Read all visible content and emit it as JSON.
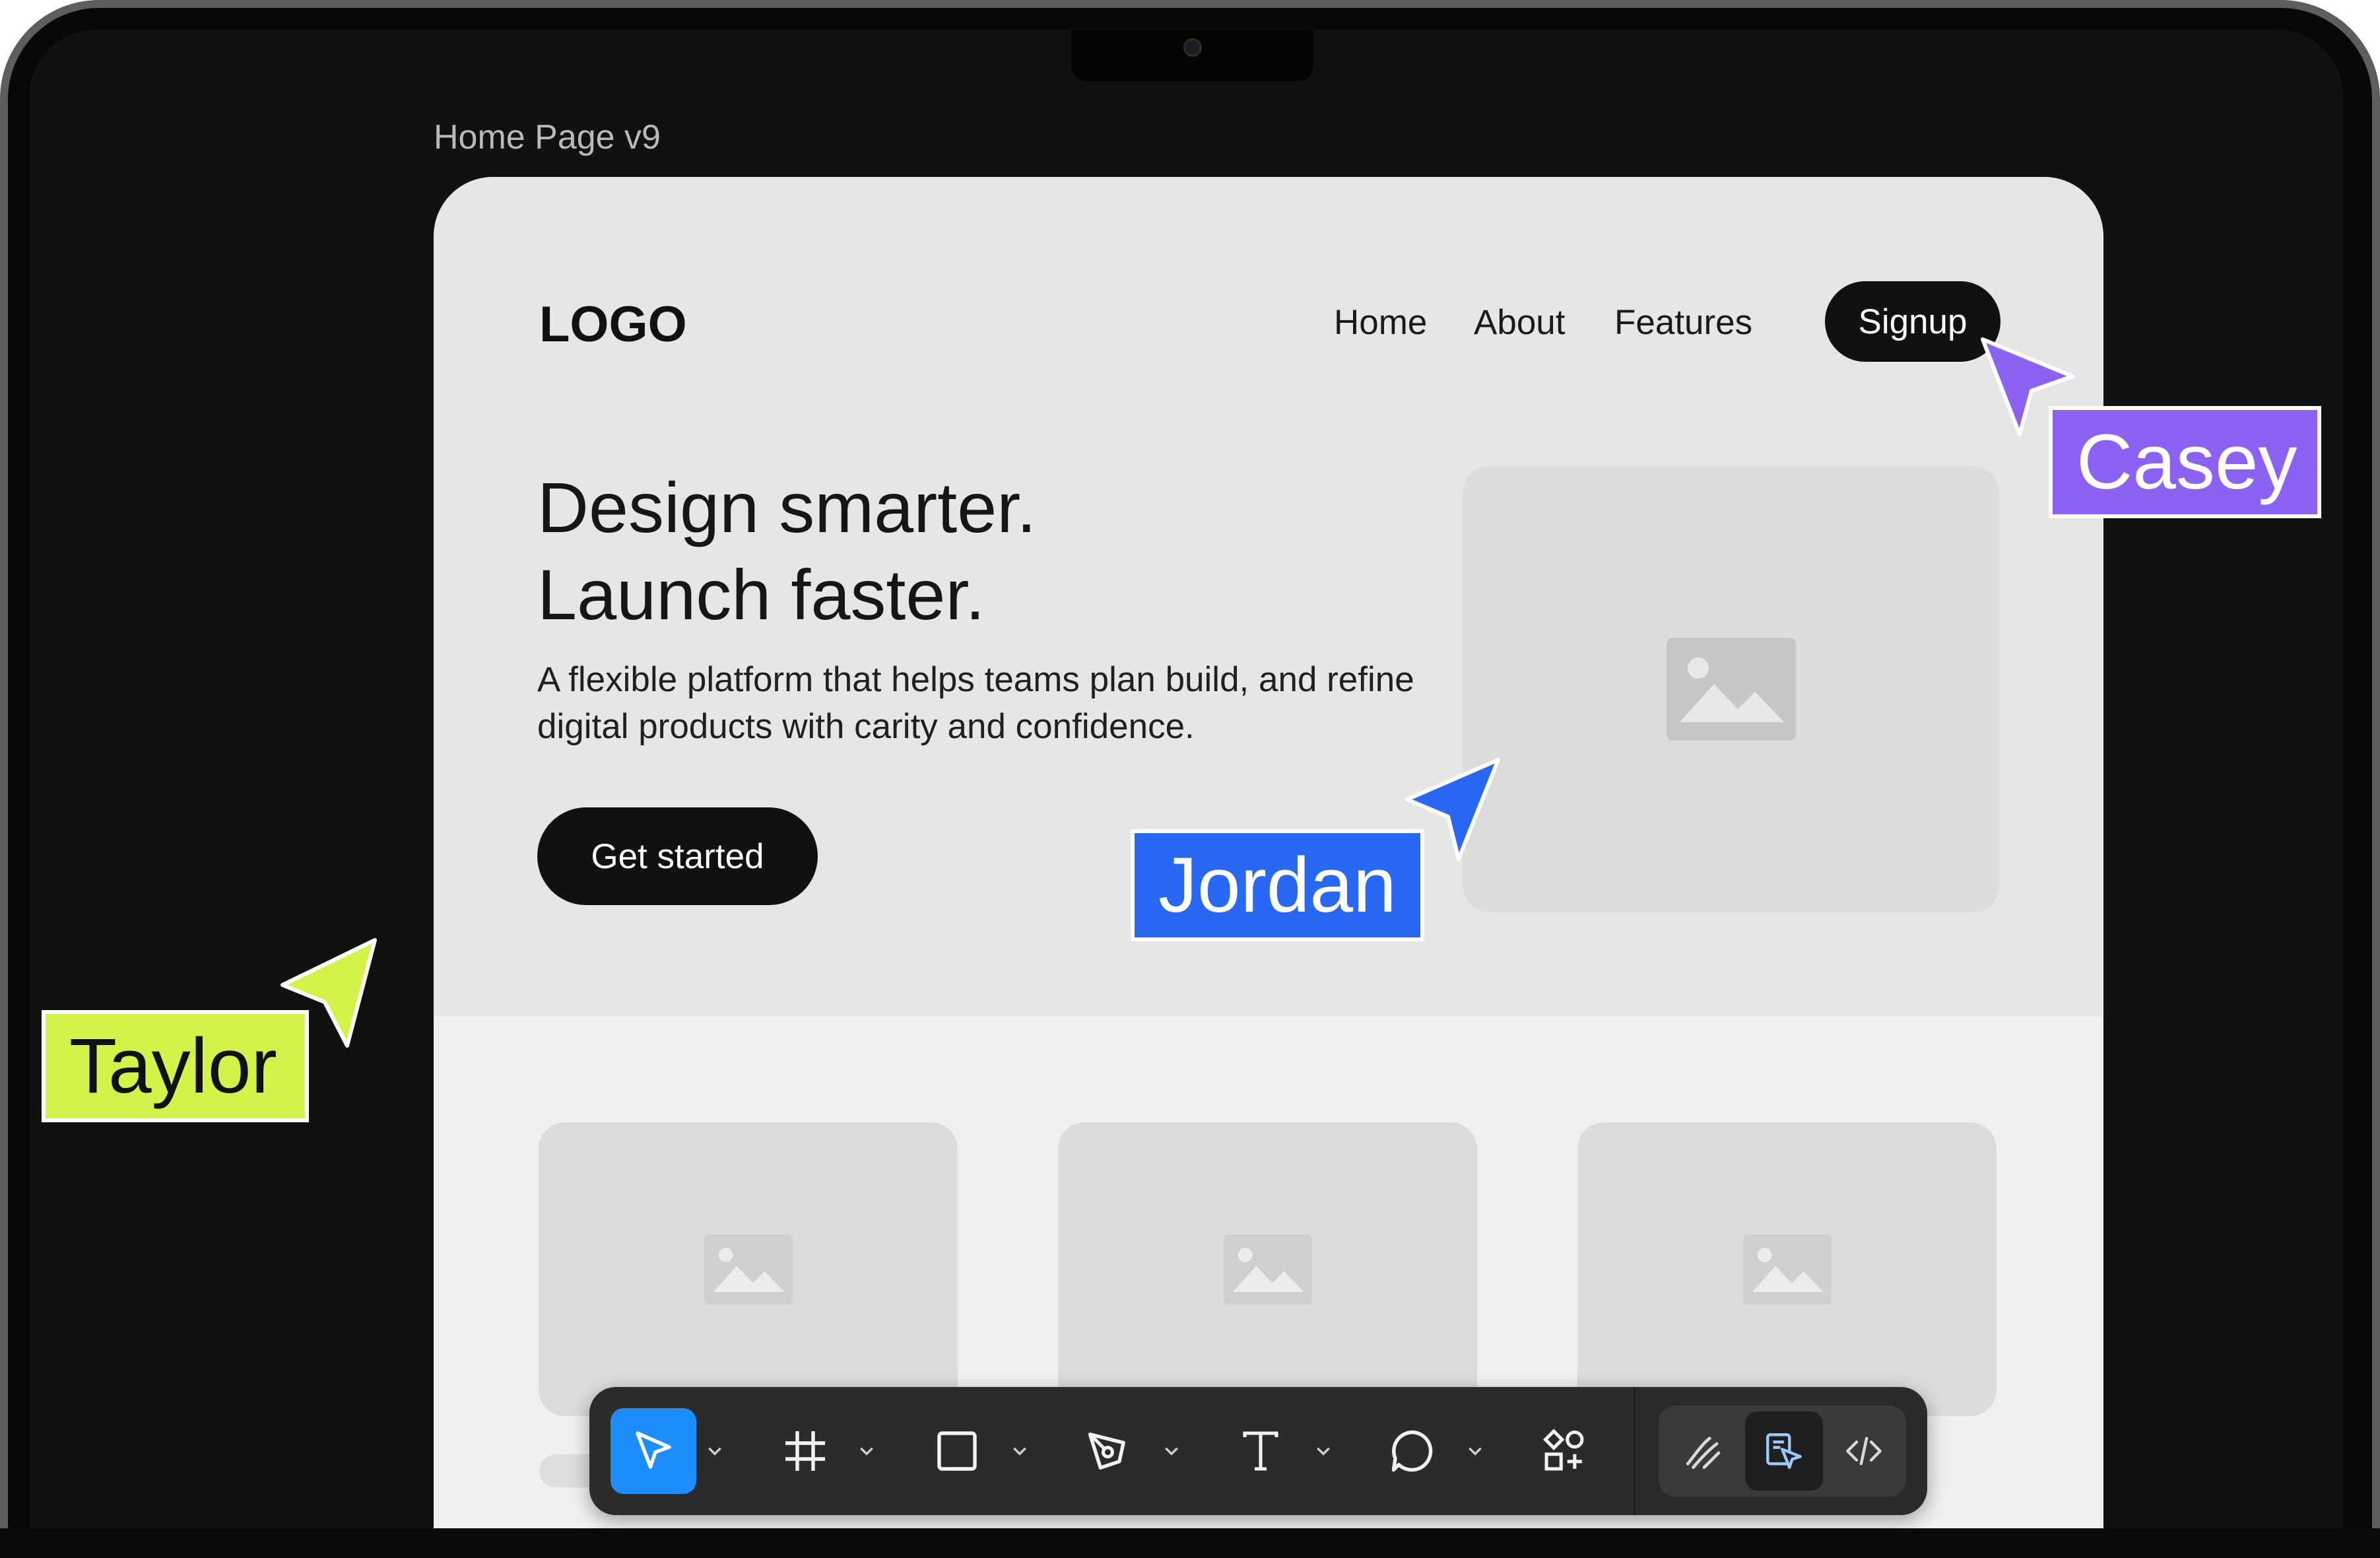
{
  "frame": {
    "label": "Home Page v9"
  },
  "page": {
    "logo": "LOGO",
    "nav": [
      {
        "label": "Home"
      },
      {
        "label": "About"
      },
      {
        "label": "Features"
      }
    ],
    "signup_label": "Signup",
    "headline_line1": "Design smarter.",
    "headline_line2": "Launch faster.",
    "subtext": "A flexible platform that helps teams plan build, and refine digital products with carity and confidence.",
    "cta_label": "Get started"
  },
  "cursors": [
    {
      "name": "Taylor",
      "color": "#d4f34a"
    },
    {
      "name": "Jordan",
      "color": "#2868f3"
    },
    {
      "name": "Casey",
      "color": "#8b62f2"
    }
  ],
  "toolbar": {
    "tools": [
      {
        "icon": "move-cursor-icon",
        "selected": true
      },
      {
        "icon": "frame-icon"
      },
      {
        "icon": "rectangle-icon"
      },
      {
        "icon": "pen-icon"
      },
      {
        "icon": "text-icon"
      },
      {
        "icon": "comment-icon"
      },
      {
        "icon": "components-icon"
      }
    ],
    "modes": [
      {
        "icon": "draw-icon"
      },
      {
        "icon": "design-mode-icon",
        "selected": true
      },
      {
        "icon": "code-icon"
      }
    ]
  },
  "colors": {
    "accent": "#1e8eff",
    "canvas": "#f0f0f0",
    "toolbar": "#2b2b2b"
  }
}
